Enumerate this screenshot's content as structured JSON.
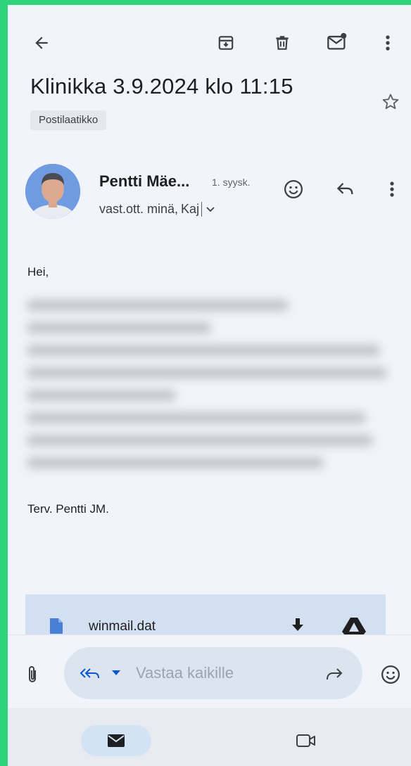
{
  "toolbar": {
    "back_icon": "arrow-left-icon",
    "archive_icon": "archive-icon",
    "delete_icon": "trash-icon",
    "mark_unread_icon": "mail-unread-icon",
    "more_icon": "more-vert-icon"
  },
  "message": {
    "subject": "Klinikka 3.9.2024 klo 11:15",
    "label": "Postilaatikko",
    "sender": "Pentti Mäe...",
    "date": "1. syysk.",
    "recipients_prefix": "vast.ott. minä,",
    "recipients_last": "Kaj",
    "greeting": "Hei,",
    "signature": "Terv. Pentti JM."
  },
  "attachment": {
    "filename": "winmail.dat"
  },
  "reply": {
    "placeholder": "Vastaa kaikille"
  },
  "colors": {
    "accent_blue": "#0b57d0",
    "background": "#f1f5fb",
    "frame": "#2ed47a"
  }
}
